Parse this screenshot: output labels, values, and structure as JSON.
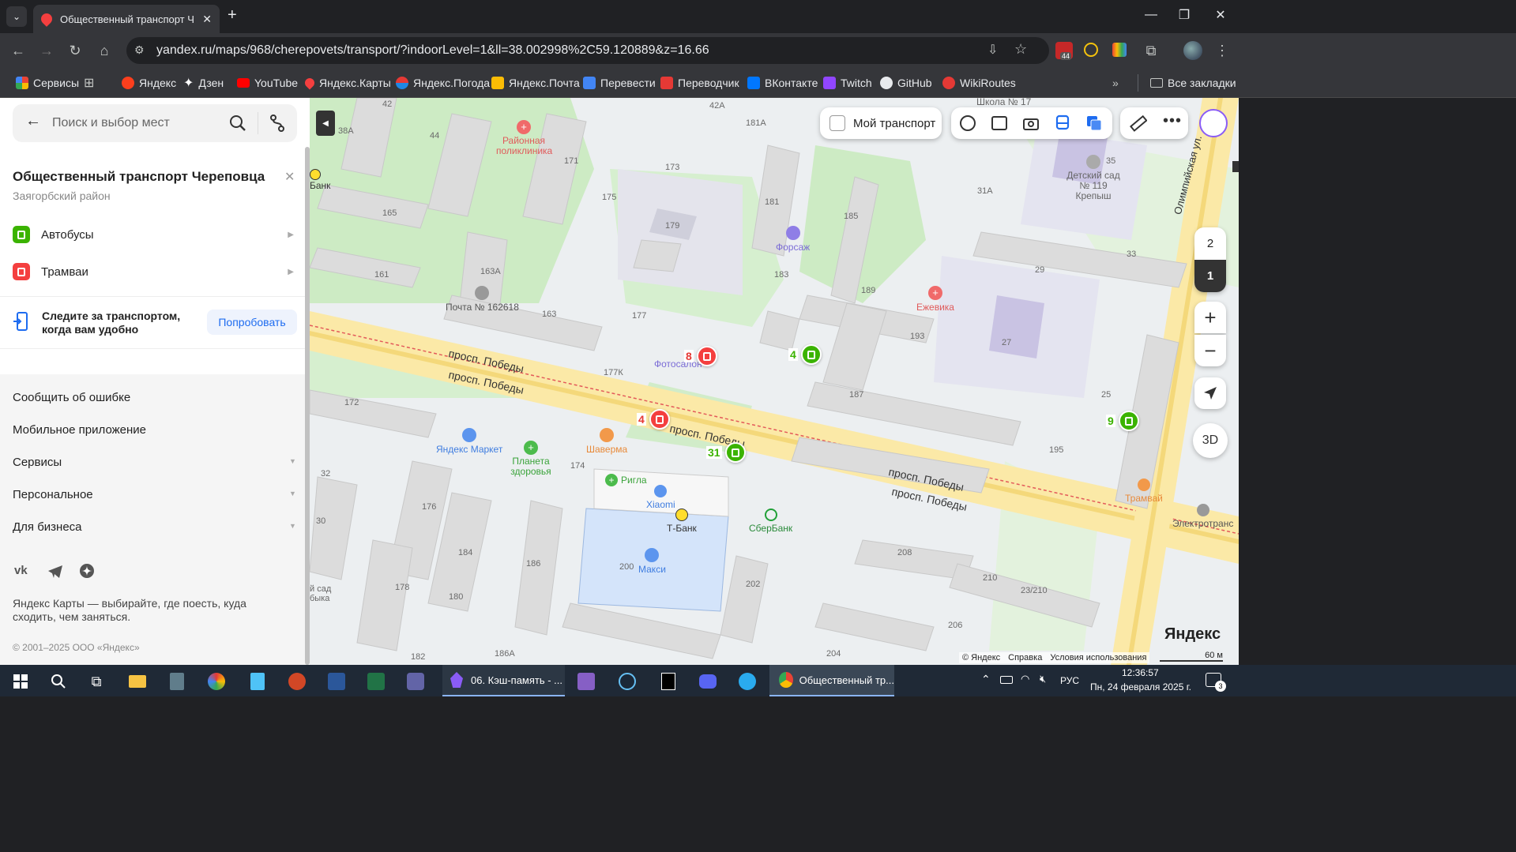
{
  "browser": {
    "tab_title": "Общественный транспорт Чер",
    "url": "yandex.ru/maps/968/cherepovets/transport/?indoorLevel=1&ll=38.002998%2C59.120889&z=16.66",
    "extension_badge": "44"
  },
  "bookmarks": [
    {
      "label": "Сервисы"
    },
    {
      "label": "Яндекс"
    },
    {
      "label": "Дзен"
    },
    {
      "label": "YouTube"
    },
    {
      "label": "Яндекс.Карты"
    },
    {
      "label": "Яндекс.Погода"
    },
    {
      "label": "Яндекс.Почта"
    },
    {
      "label": "Перевести"
    },
    {
      "label": "Переводчик"
    },
    {
      "label": "ВКонтакте"
    },
    {
      "label": "Twitch"
    },
    {
      "label": "GitHub"
    },
    {
      "label": "WikiRoutes"
    }
  ],
  "bookmarks_all": "Все закладки",
  "sidebar": {
    "search_placeholder": "Поиск и выбор мест",
    "title": "Общественный транспорт Череповца",
    "district": "Заягорбский район",
    "transport": [
      {
        "label": "Автобусы",
        "color": "#3bb300"
      },
      {
        "label": "Трамваи",
        "color": "#f43f3f"
      }
    ],
    "promo_text": "Следите за транспортом, когда вам удобно",
    "promo_button": "Попробовать",
    "links": [
      "Сообщить об ошибке",
      "Мобильное приложение",
      "Сервисы",
      "Персональное",
      "Для бизнеса"
    ],
    "about": "Яндекс Карты — выбирайте, где поесть, куда сходить, чем заняться.",
    "copyright": "© 2001–2025 ООО «Яндекс»"
  },
  "map": {
    "my_transport": "Мой транспорт",
    "floors": [
      "2",
      "1"
    ],
    "btn_3d": "3D",
    "logo": "Яндекс",
    "footer_links": [
      "© Яндекс",
      "Справка",
      "Условия использования"
    ],
    "scale": "60 м",
    "streets": [
      "просп. Победы",
      "просп. Победы",
      "просп. Победы",
      "просп. Победы",
      "просп. Победы",
      "Олимпийская ул."
    ],
    "poi": {
      "clinic": "Районная поликлиника",
      "post": "Почта № 162618",
      "forsazh": "Форсаж",
      "yezhevika": "Ежевика",
      "kindergarten": "Детский сад № 119 Крепыш",
      "school": "Школа № 17",
      "fotosalon": "Фотосалон",
      "yandex_market": "Яндекс Маркет",
      "planeta": "Планета здоровья",
      "shaverma": "Шаверма",
      "rigla": "Ригла",
      "xiaomi": "Xiaomi",
      "tbank": "Т-Банк",
      "sberbank": "СберБанк",
      "maxi": "Макси",
      "tramvai": "Трамвай",
      "elektrotrans": "Электротранс",
      "bank_left": "Банк",
      "kindergarten_left": "й сад быка"
    },
    "stops": [
      {
        "route": "8",
        "kind": "tram"
      },
      {
        "route": "4",
        "kind": "bus"
      },
      {
        "route": "4",
        "kind": "tram"
      },
      {
        "route": "31",
        "kind": "bus"
      },
      {
        "route": "9",
        "kind": "bus"
      }
    ],
    "buildings": [
      "42",
      "42А",
      "181А",
      "38А",
      "44",
      "171",
      "173",
      "165",
      "175",
      "179",
      "181",
      "185",
      "31А",
      "35",
      "163А",
      "161",
      "183",
      "189",
      "33",
      "29",
      "163",
      "177",
      "193",
      "27",
      "177К",
      "187",
      "25",
      "172",
      "195",
      "32",
      "174",
      "176",
      "30",
      "184",
      "186",
      "178",
      "180",
      "200",
      "202",
      "208",
      "210",
      "23/210",
      "206",
      "204",
      "182",
      "186А"
    ]
  },
  "taskbar": {
    "apps": [
      "06. Кэш-память - ...",
      "Общественный тр..."
    ],
    "lang": "РУС",
    "time": "12:36:57",
    "date": "Пн, 24 февраля 2025 г.",
    "notifications": "3"
  }
}
